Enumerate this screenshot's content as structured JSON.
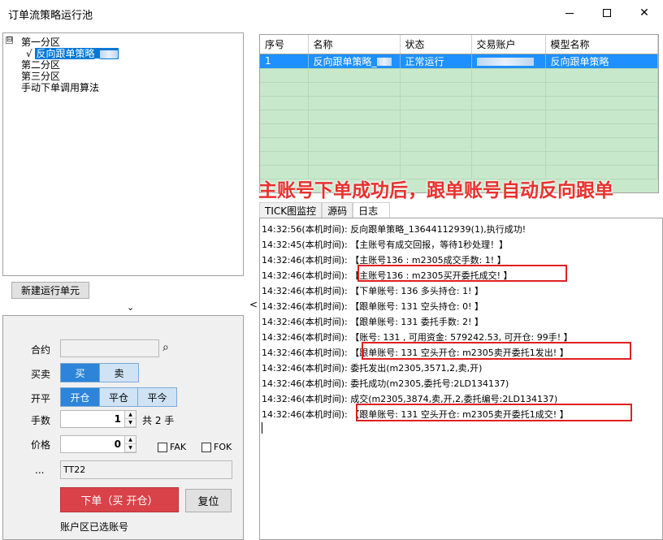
{
  "window": {
    "title": "订单流策略运行池"
  },
  "tree": {
    "expander": "⊟",
    "group1": "第一分区",
    "check": "√",
    "item1": "反向跟单策略_",
    "group2": "第二分区",
    "group3": "第三分区",
    "group4": "手动下单调用算法"
  },
  "new_unit_label": "新建运行单元",
  "chevron": "⌄",
  "splitter_arrow": "<",
  "order": {
    "contract_label": "合约",
    "contract_value": "",
    "side_label": "买卖",
    "buy": "买",
    "sell": "卖",
    "oc_label": "开平",
    "open": "开仓",
    "close": "平仓",
    "close_today": "平今",
    "qty_label": "手数",
    "qty_value": "1",
    "qty_total": "共 2 手",
    "price_label": "价格",
    "price_value": "0",
    "fak": "FAK",
    "fok": "FOK",
    "dots": "...",
    "algo_value": "TT22",
    "submit": "下单（买 开仓）",
    "reset": "复位",
    "account_note": "账户区已选账号"
  },
  "grid": {
    "headers": [
      "序号",
      "名称",
      "状态",
      "交易账户",
      "模型名称"
    ],
    "rows": [
      [
        "1",
        "反向跟单策略_",
        "正常运行",
        "",
        "反向跟单策略"
      ]
    ]
  },
  "caption": "主账号下单成功后，跟单账号自动反向跟单",
  "tabs": [
    "TICK图监控",
    "源码",
    "日志"
  ],
  "log": [
    "14:32:56(本机时间): 反向跟单策略_13644112939(1),执行成功!",
    "14:32:45(本机时间): 【主账号有成交回报，等待1秒处理！】",
    "14:32:46(本机时间): 【主账号136        : m2305成交手数: 1! 】",
    "14:32:46(本机时间): 【主账号136         : m2305买开委托成交! 】",
    "14:32:46(本机时间): 【下单账号: 136        多头持仓: 1! 】",
    "14:32:46(本机时间): 【跟单账号: 131         空头持仓: 0! 】",
    "14:32:46(本机时间): 【跟单账号: 131         委托手数: 2! 】",
    "14:32:46(本机时间): 【账号: 131        , 可用资金: 579242.53, 可开仓: 99手! 】",
    "14:32:46(本机时间): 【跟单账号: 131         空头开仓: m2305卖开委托1发出! 】",
    "14:32:46(本机时间): 委托发出(m2305,3571,2,卖,开)",
    "14:32:46(本机时间): 委托成功(m2305,委托号:2LD134137)",
    "14:32:46(本机时间): 成交(m2305,3874,卖,开,2,委托编号:2LD134137)",
    "14:32:46(本机时间): 【跟单账号: 131         空头开仓: m2305卖开委托1成交! 】"
  ],
  "colors": {
    "accent": "#2d84d8",
    "submit": "#d94249",
    "grid_bg": "#c8e8cc",
    "selected_row": "#1e90ff",
    "caption": "#e8312f",
    "highlight_box": "#e02020"
  }
}
